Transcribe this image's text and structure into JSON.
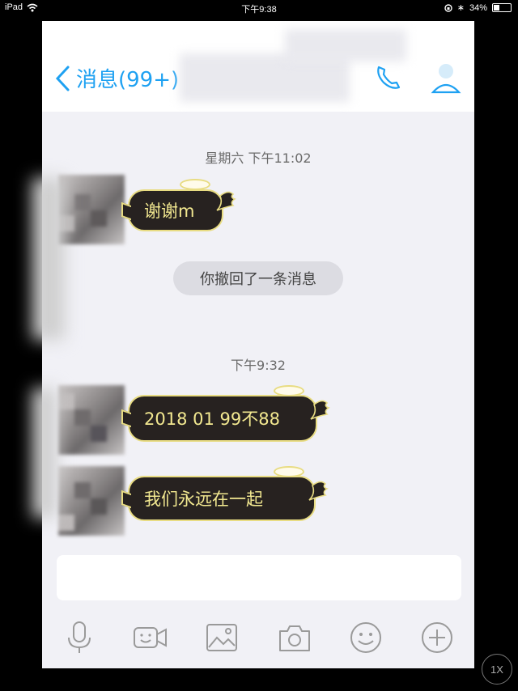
{
  "status_bar": {
    "device": "iPad",
    "time": "下午9:38",
    "battery": "34%",
    "battery_level": 0.34
  },
  "nav": {
    "back_label": "消息(99+)"
  },
  "messages": [
    {
      "type": "timestamp",
      "text": "星期六 下午11:02"
    },
    {
      "type": "bubble",
      "text": "谢谢m"
    },
    {
      "type": "system",
      "text": "你撤回了一条消息"
    },
    {
      "type": "timestamp",
      "text": "下午9:32"
    },
    {
      "type": "bubble",
      "text": "2018 01 99不88"
    },
    {
      "type": "bubble",
      "text": "我们永远在一起"
    }
  ],
  "toolbar": {
    "icons": [
      "microphone-icon",
      "video-icon",
      "image-icon",
      "camera-icon",
      "emoji-icon",
      "plus-icon"
    ]
  },
  "zoom_badge": "1X",
  "colors": {
    "accent": "#1ea1f2",
    "bubble_bg": "#272220",
    "bubble_text": "#f2e890",
    "bubble_border": "#e8dc82",
    "chat_bg": "#f1f1f6"
  }
}
